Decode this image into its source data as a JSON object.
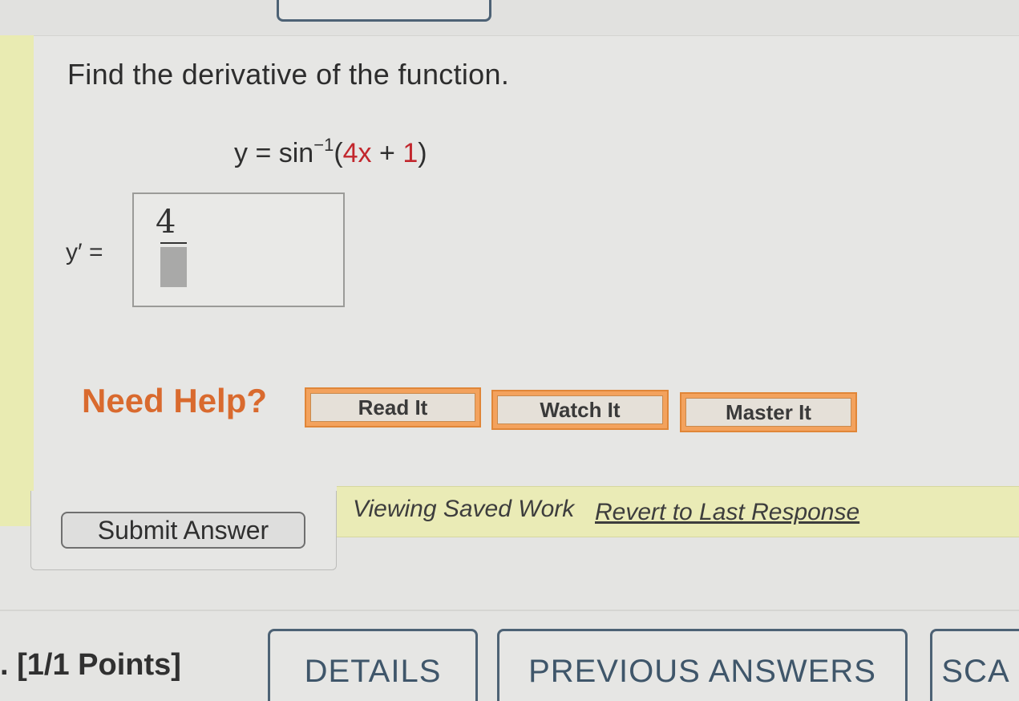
{
  "question": {
    "prompt": "Find the derivative of the function.",
    "equation": {
      "lhs": "y = sin",
      "exponent": "−1",
      "open": "(",
      "term1": "4x",
      "plus": " + ",
      "term2": "1",
      "close": ")"
    }
  },
  "answer": {
    "label": "y′ =",
    "numerator": "4"
  },
  "help": {
    "heading": "Need Help?",
    "buttons": [
      "Read It",
      "Watch It",
      "Master It"
    ]
  },
  "submit": {
    "label": "Submit Answer"
  },
  "status": {
    "viewing": "Viewing Saved Work",
    "revert_link": "Revert to Last Response"
  },
  "footer": {
    "points": ". [1/1 Points]",
    "tabs": [
      "DETAILS",
      "PREVIOUS ANSWERS",
      "SCA"
    ]
  },
  "colors": {
    "accent_orange": "#d96a2e",
    "button_orange": "#f3a25d",
    "saved_banner": "#eaebb6",
    "tab_border": "#4d6275"
  }
}
